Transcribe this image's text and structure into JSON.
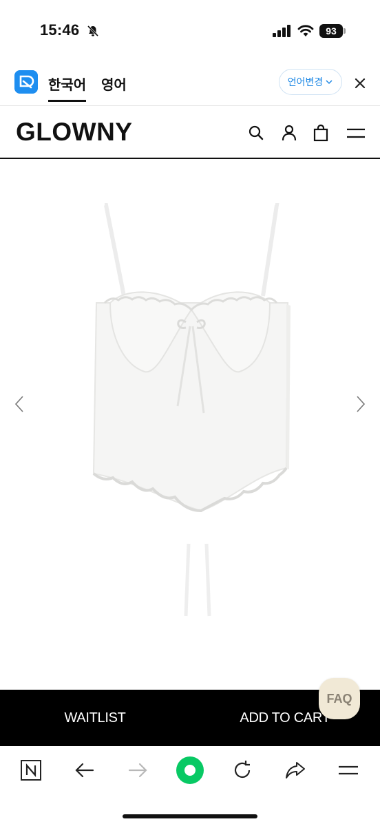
{
  "status_bar": {
    "time": "15:46",
    "battery": "93",
    "icons": [
      "bell-muted-icon",
      "signal-icon",
      "wifi-icon",
      "battery-icon"
    ]
  },
  "translate_bar": {
    "logo_icon": "translate-logo-icon",
    "tabs": [
      {
        "label": "한국어",
        "active": true
      },
      {
        "label": "영어",
        "active": false
      }
    ],
    "change_language_label": "언어변경",
    "close_icon": "close-icon",
    "accent_color": "#1e88e5"
  },
  "header": {
    "logo": "GLOWNY",
    "icons": [
      "search-icon",
      "user-icon",
      "bag-icon",
      "menu-icon"
    ]
  },
  "product": {
    "image": "white-lace-bustier-top-image",
    "prev_icon": "chevron-left-icon",
    "next_icon": "chevron-right-icon"
  },
  "actions": {
    "waitlist_label": "WAITLIST",
    "add_to_cart_label": "ADD TO CART",
    "faq_label": "FAQ",
    "bar_color": "#000000"
  },
  "browser_toolbar": {
    "icons": [
      "naver-n-icon",
      "back-arrow-icon",
      "forward-arrow-icon",
      "home-green-icon",
      "reload-icon",
      "share-icon",
      "more-menu-icon"
    ],
    "home_color": "#08c964"
  }
}
